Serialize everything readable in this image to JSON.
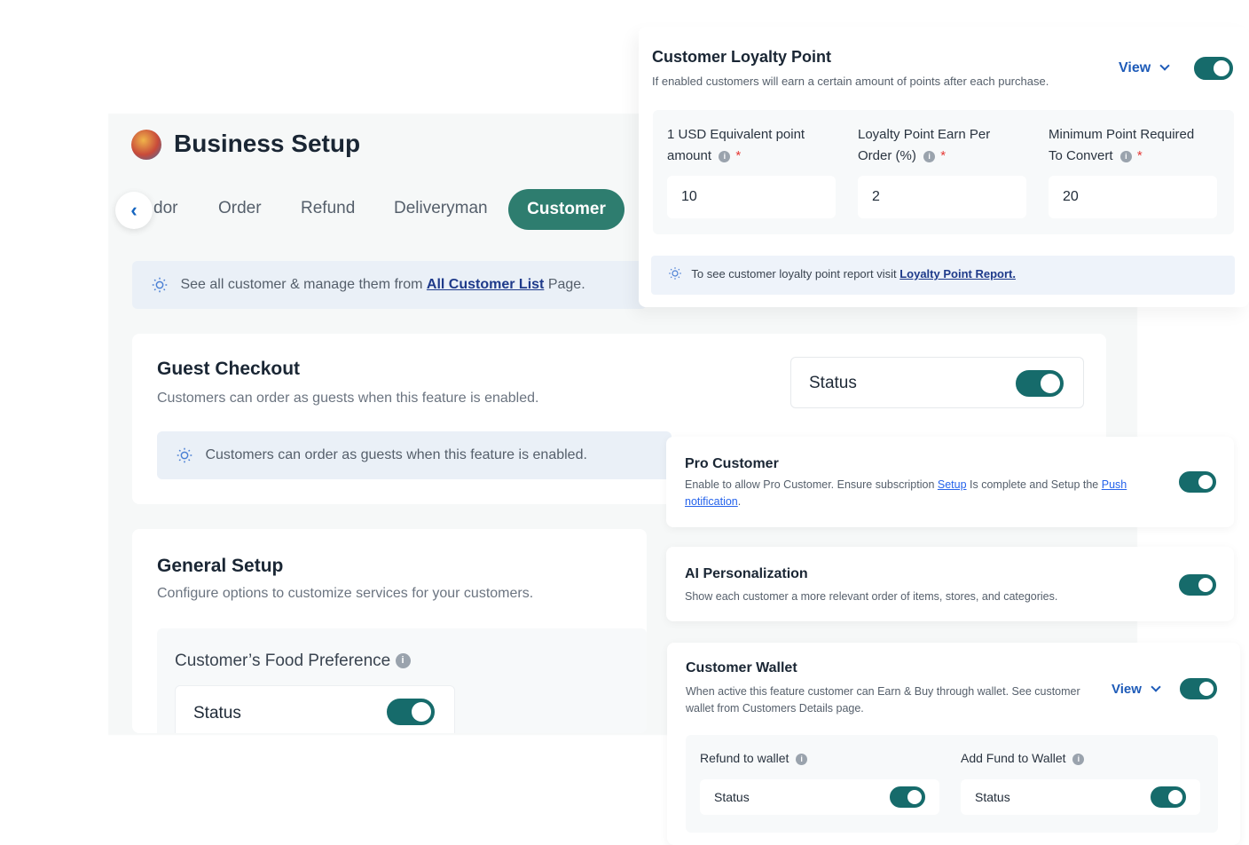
{
  "business_setup": {
    "title": "Business Setup",
    "tabs": [
      "dor",
      "Order",
      "Refund",
      "Deliveryman"
    ],
    "active_tab": "Customer",
    "note": {
      "prefix": "See all customer & manage them from ",
      "link": "All Customer List",
      "suffix": " Page."
    }
  },
  "guest_checkout": {
    "title": "Guest Checkout",
    "description": "Customers can order as guests when this feature is enabled.",
    "status_label": "Status",
    "note": "Customers can order as guests when this feature is enabled."
  },
  "general_setup": {
    "title": "General Setup",
    "description": "Configure options to customize services for your customers.",
    "food_preference": {
      "title": "Customer’s Food Preference",
      "status_label": "Status"
    }
  },
  "loyalty": {
    "title": "Customer Loyalty Point",
    "description": "If enabled customers will earn a certain amount of points after each purchase.",
    "view_label": "View",
    "fields": [
      {
        "label_line1": "1 USD Equivalent point",
        "label_line2": "amount",
        "value": "10"
      },
      {
        "label_line1": "Loyalty Point Earn Per",
        "label_line2": "Order (%)",
        "value": "2"
      },
      {
        "label_line1": "Minimum Point Required",
        "label_line2": "To Convert",
        "value": "20"
      }
    ],
    "note": {
      "prefix": "To see customer loyalty point report visit ",
      "link": "Loyalty Point Report."
    }
  },
  "pro_customer": {
    "title": "Pro Customer",
    "desc_1": "Enable to allow Pro Customer. Ensure subscription ",
    "link_setup": "Setup",
    "desc_2": " Is complete and Setup the ",
    "link_push": "Push",
    "link_notification": "notification",
    "desc_end": "."
  },
  "ai_personalization": {
    "title": "AI Personalization",
    "description": "Show each customer a more relevant order of items, stores, and categories."
  },
  "wallet": {
    "title": "Customer Wallet",
    "description": "When active this feature customer can Earn & Buy through wallet. See customer wallet from Customers Details page.",
    "view_label": "View",
    "refund": {
      "label": "Refund to wallet",
      "status_label": "Status"
    },
    "add_fund": {
      "label": "Add Fund to Wallet",
      "status_label": "Status"
    }
  },
  "colors": {
    "accent": "#166b6b",
    "tab_active": "#2e7d6f",
    "link": "#1e5bb8"
  }
}
